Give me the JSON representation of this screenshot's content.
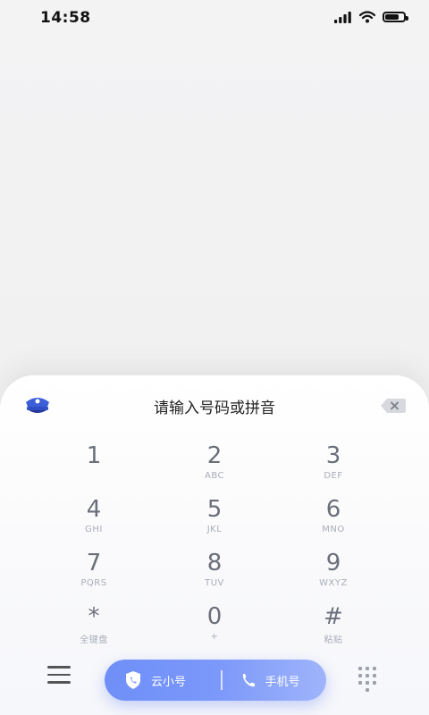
{
  "status_bar": {
    "time": "14:58"
  },
  "dial_panel": {
    "placeholder": "请输入号码或拼音",
    "keys": [
      {
        "digit": "1",
        "letters": ""
      },
      {
        "digit": "2",
        "letters": "ABC"
      },
      {
        "digit": "3",
        "letters": "DEF"
      },
      {
        "digit": "4",
        "letters": "GHI"
      },
      {
        "digit": "5",
        "letters": "JKL"
      },
      {
        "digit": "6",
        "letters": "MNO"
      },
      {
        "digit": "7",
        "letters": "PQRS"
      },
      {
        "digit": "8",
        "letters": "TUV"
      },
      {
        "digit": "9",
        "letters": "WXYZ"
      },
      {
        "digit": "*",
        "letters": "全键盘"
      },
      {
        "digit": "0",
        "letters": "+"
      },
      {
        "digit": "#",
        "letters": "粘贴"
      }
    ]
  },
  "bottom_bar": {
    "cloud_call_label": "云小号",
    "phone_call_label": "手机号"
  },
  "colors": {
    "accent": "#7b98fa",
    "digit": "#6b6f7a",
    "letters": "#a9adb8"
  },
  "icons": [
    "police-cap-icon",
    "backspace-icon",
    "menu-icon",
    "shield-phone-icon",
    "phone-icon",
    "dialpad-icon",
    "signal-icon",
    "wifi-icon",
    "battery-icon"
  ]
}
